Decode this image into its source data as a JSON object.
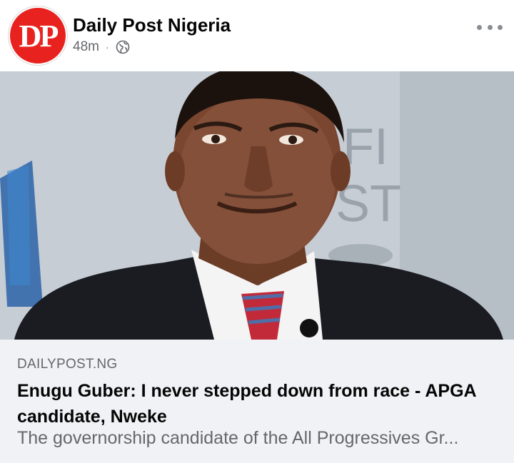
{
  "post": {
    "page_name": "Daily Post Nigeria",
    "logo_text": "DP",
    "time": "48m",
    "separator": "·",
    "audience_icon": "globe-icon",
    "more_icon": "more-options-icon"
  },
  "image": {
    "description": "photo-of-man-in-suit",
    "backdrop_text_1": "FI",
    "backdrop_text_2": "ST"
  },
  "link": {
    "domain": "DAILYPOST.NG",
    "headline": "Enugu Guber: I never stepped down from race - APGA candidate, Nweke",
    "description": "The governorship candidate of the All Progressives Gr..."
  },
  "colors": {
    "brand_red": "#e8231f",
    "text_primary": "#050505",
    "text_secondary": "#65676b",
    "link_bg": "#f0f2f5"
  }
}
